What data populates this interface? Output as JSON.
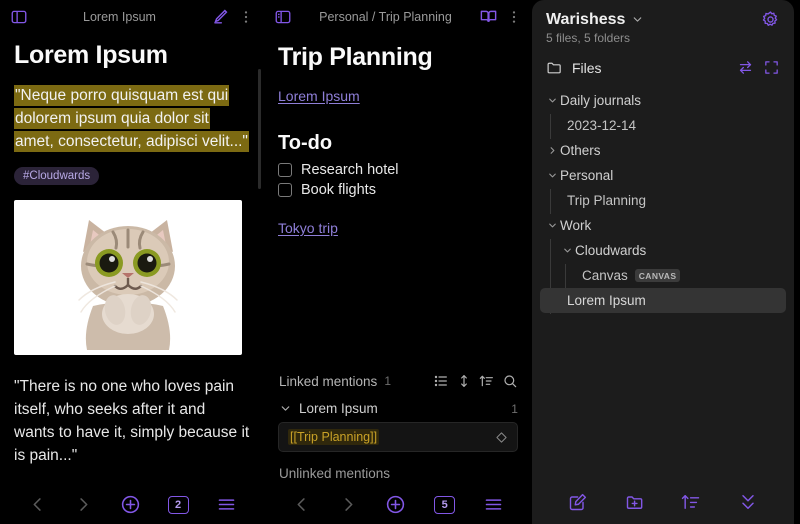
{
  "colors": {
    "accent": "#8257e6",
    "accent_light": "#b69cf0",
    "highlight_bg": "#7c6a12",
    "mention_text": "#c9a227",
    "sidebar_bg": "#1c1c1c",
    "canvas_bg": "#000000",
    "link": "#8f7fd8",
    "tag_bg": "#2b2338",
    "tag_text": "#b8a9e6"
  },
  "left_panel": {
    "topbar": {
      "sidebar_toggle_icon": "sidebar-left-icon",
      "title": "Lorem Ipsum",
      "edit_icon": "pencil-icon",
      "more_icon": "kebab-menu-icon"
    },
    "heading": "Lorem Ipsum",
    "quote_highlighted": "\"Neque porro quisquam est qui dolorem ipsum quia dolor sit amet, consectetur, adipisci velit...\"",
    "tag": "#Cloudwards",
    "image_alt": "cat-photo",
    "paragraph": "\"There is no one who loves pain itself, who seeks after it and wants to have it, simply because it is pain...\"",
    "bottom_nav": {
      "back_icon": "chevron-left-icon",
      "forward_icon": "chevron-right-icon",
      "new_icon": "plus-circle-icon",
      "tab_count": "2",
      "menu_icon": "hamburger-menu-icon"
    }
  },
  "mid_panel": {
    "topbar": {
      "sidebar_toggle_icon": "sidebar-left-icon",
      "breadcrumb": "Personal / Trip Planning",
      "reading_icon": "book-open-icon",
      "more_icon": "kebab-menu-icon"
    },
    "heading": "Trip Planning",
    "internal_link": "Lorem Ipsum",
    "todo_heading": "To-do",
    "todos": [
      {
        "label": "Research hotel",
        "checked": false
      },
      {
        "label": "Book flights",
        "checked": false
      }
    ],
    "external_link": "Tokyo trip",
    "mentions": {
      "linked_label": "Linked mentions",
      "linked_count": "1",
      "list_icon": "list-icon",
      "collapse_icon": "expand-vertical-icon",
      "sort_icon": "sort-asc-icon",
      "search_icon": "search-icon",
      "group_chevron_icon": "chevron-down-icon",
      "group_name": "Lorem Ipsum",
      "group_count": "1",
      "snippet": "[[Trip Planning]]",
      "snippet_action_icon": "diamond-icon",
      "unlinked_label": "Unlinked mentions"
    },
    "bottom_nav": {
      "back_icon": "chevron-left-icon",
      "forward_icon": "chevron-right-icon",
      "new_icon": "plus-circle-icon",
      "tab_count": "5",
      "menu_icon": "hamburger-menu-icon"
    }
  },
  "right_panel": {
    "vault_name": "Warishess",
    "vault_chevron_icon": "chevron-down-icon",
    "settings_icon": "gear-icon",
    "vault_stats": "5 files, 5 folders",
    "files_icon": "folder-icon",
    "files_label": "Files",
    "swap_icon": "swap-icon",
    "expand_icon": "expand-frame-icon",
    "tree": [
      {
        "label": "Daily journals",
        "type": "folder",
        "depth": 0,
        "expanded": true,
        "selected": false
      },
      {
        "label": "2023-12-14",
        "type": "file",
        "depth": 1,
        "expanded": null,
        "selected": false
      },
      {
        "label": "Others",
        "type": "folder",
        "depth": 0,
        "expanded": false,
        "selected": false
      },
      {
        "label": "Personal",
        "type": "folder",
        "depth": 0,
        "expanded": true,
        "selected": false
      },
      {
        "label": "Trip Planning",
        "type": "file",
        "depth": 1,
        "expanded": null,
        "selected": false
      },
      {
        "label": "Work",
        "type": "folder",
        "depth": 0,
        "expanded": true,
        "selected": false
      },
      {
        "label": "Cloudwards",
        "type": "folder",
        "depth": 1,
        "expanded": true,
        "selected": false
      },
      {
        "label": "Canvas",
        "type": "file",
        "depth": 2,
        "expanded": null,
        "selected": false,
        "badge": "CANVAS"
      },
      {
        "label": "Lorem Ipsum",
        "type": "file",
        "depth": 1,
        "expanded": null,
        "selected": true
      }
    ],
    "bottom_nav": {
      "new_note_icon": "new-note-icon",
      "new_folder_icon": "new-folder-icon",
      "sort_icon": "sort-asc-icon",
      "collapse_icon": "collapse-all-icon"
    }
  }
}
